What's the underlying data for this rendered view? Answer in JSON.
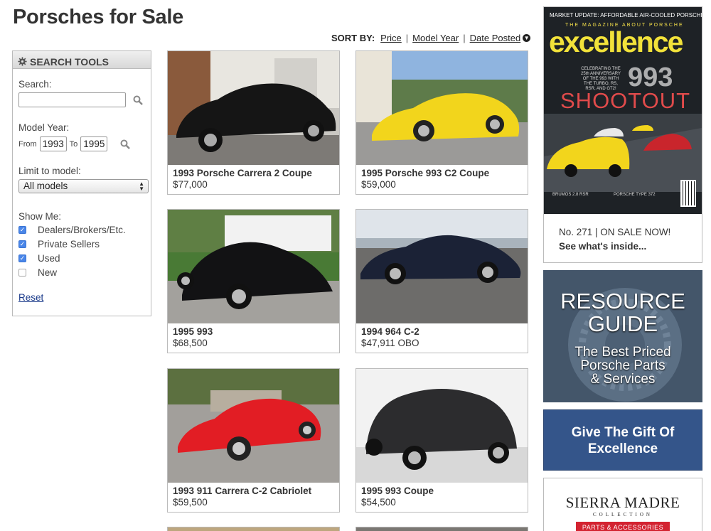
{
  "page": {
    "title": "Porsches for Sale"
  },
  "sort": {
    "label": "SORT BY:",
    "options": [
      "Price",
      "Model Year",
      "Date Posted"
    ],
    "active_icon": "circle-down-arrow-icon"
  },
  "search_tools": {
    "heading": "SEARCH TOOLS",
    "search_label": "Search:",
    "search_value": "",
    "model_year_label": "Model Year:",
    "from_label": "From",
    "from_value": "1993",
    "to_label": "To",
    "to_value": "1995",
    "limit_label": "Limit to model:",
    "model_selected": "All models",
    "show_label": "Show Me:",
    "filters": [
      {
        "label": "Dealers/Brokers/Etc.",
        "checked": true
      },
      {
        "label": "Private Sellers",
        "checked": true
      },
      {
        "label": "Used",
        "checked": true
      },
      {
        "label": "New",
        "checked": false
      }
    ],
    "reset_label": "Reset"
  },
  "listings": [
    {
      "title": "1993 Porsche Carrera 2 Coupe",
      "price": "$77,000",
      "car_color": "#151515"
    },
    {
      "title": "1995 Porsche 993 C2 Coupe",
      "price": "$59,000",
      "car_color": "#f2d51c"
    },
    {
      "title": "1995 993",
      "price": "$68,500",
      "car_color": "#121214"
    },
    {
      "title": "1994 964 C-2",
      "price": "$47,911 OBO",
      "car_color": "#1b2236"
    },
    {
      "title": "1993 911 Carrera C-2 Cabriolet",
      "price": "$59,500",
      "car_color": "#e21d24"
    },
    {
      "title": "1995 993 Coupe",
      "price": "$54,500",
      "car_color": "#2c2c2e"
    }
  ],
  "magazine": {
    "top_line": "MARKET UPDATE: AFFORDABLE AIR-COOLED PORSCHES",
    "tagline": "THE MAGAZINE ABOUT PORSCHE",
    "logo": "excellence",
    "anniversary": "CELEBRATING THE 25th ANNIVERSARY OF THE 993 WITH THE TURBO, RS, RSR, AND GT2!",
    "big_number": "993",
    "headline": "SHOOTOUT",
    "foot_left": "BRUMOS 2.8 RSR",
    "foot_right": "PORSCHE TYPE 372",
    "issue_line": "No. 271 | ON SALE NOW!",
    "cta": "See what's inside..."
  },
  "resource_ad": {
    "line1": "RESOURCE",
    "line2": "GUIDE",
    "sub1": "The Best Priced",
    "sub2": "Porsche Parts",
    "sub3": "& Services"
  },
  "gift_ad": {
    "line1": "Give The Gift Of",
    "line2": "Excellence"
  },
  "sierra_ad": {
    "name": "SIERRA MADRE",
    "sub": "COLLECTION",
    "badge": "PARTS & ACCESSORIES"
  }
}
